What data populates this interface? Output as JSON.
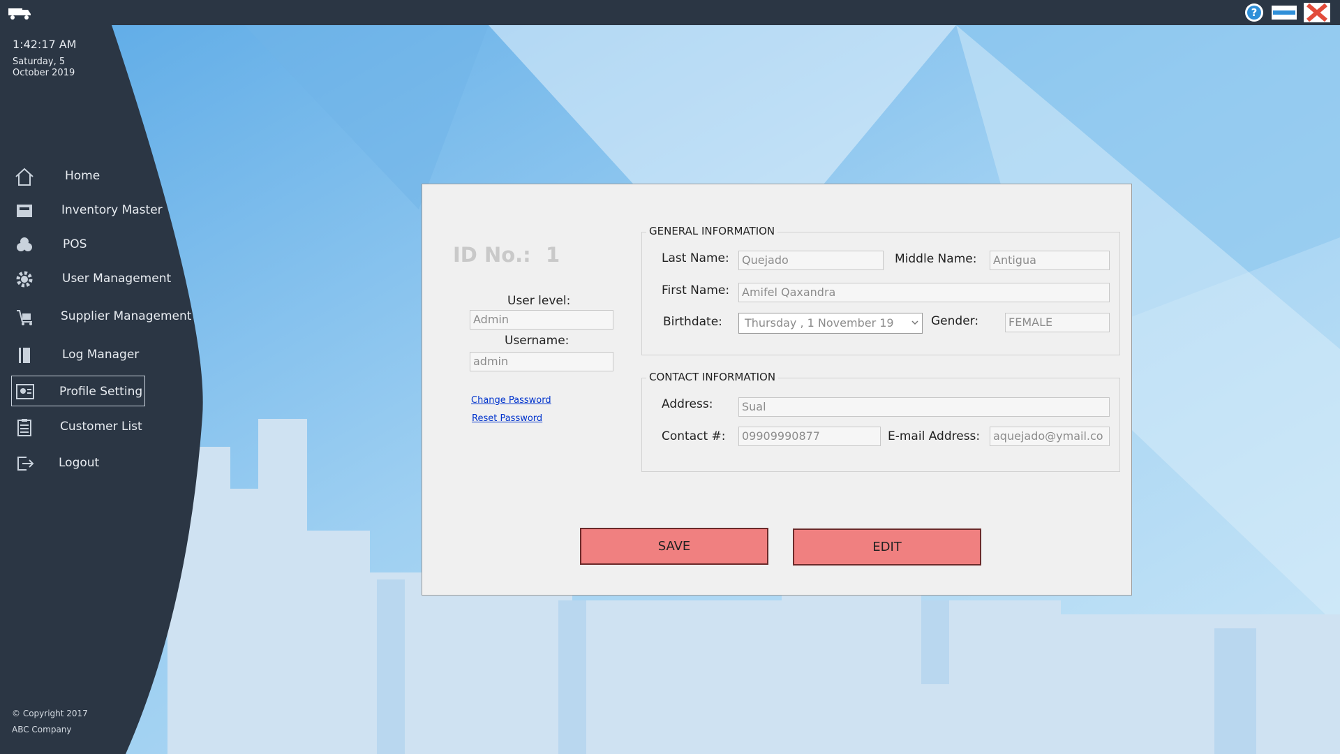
{
  "window": {
    "help_icon": "question-circle-icon",
    "minimize_icon": "minimize-bar-icon",
    "close_icon": "close-x-icon"
  },
  "sidebar": {
    "time": "1:42:17 AM",
    "date": "Saturday, 5 October 2019",
    "items": [
      {
        "label": "Home",
        "icon": "home-icon"
      },
      {
        "label": "Inventory Master",
        "icon": "inventory-icon"
      },
      {
        "label": "POS",
        "icon": "pos-icon"
      },
      {
        "label": "User Management",
        "icon": "gear-icon"
      },
      {
        "label": "Supplier Management",
        "icon": "supplier-icon"
      },
      {
        "label": "Log Manager",
        "icon": "log-icon"
      },
      {
        "label": "Profile Setting",
        "icon": "profile-icon",
        "active": true
      },
      {
        "label": "Customer List",
        "icon": "clipboard-icon"
      },
      {
        "label": "Logout",
        "icon": "logout-icon"
      }
    ],
    "copyright_line1": "© Copyright 2017",
    "copyright_line2": "ABC Company"
  },
  "profile": {
    "id_label": "ID No.:",
    "id_value": "1",
    "user_level_label": "User level:",
    "user_level_value": "Admin",
    "username_label": "Username:",
    "username_value": "admin",
    "change_password": "Change Password",
    "reset_password": "Reset Password"
  },
  "general": {
    "title": "GENERAL INFORMATION",
    "last_name_label": "Last Name:",
    "last_name_value": "Quejado",
    "middle_name_label": "Middle Name:",
    "middle_name_value": "Antigua",
    "first_name_label": "First Name:",
    "first_name_value": "Amifel Qaxandra",
    "birthdate_label": "Birthdate:",
    "birthdate_value": "Thursday   ,   1 November 19",
    "gender_label": "Gender:",
    "gender_value": "FEMALE"
  },
  "contact": {
    "title": "CONTACT INFORMATION",
    "address_label": "Address:",
    "address_value": "Sual",
    "contact_label": "Contact #:",
    "contact_value": "09909990877",
    "email_label": "E-mail Address:",
    "email_value": "aquejado@ymail.co"
  },
  "actions": {
    "save_label": "SAVE",
    "edit_label": "EDIT",
    "accent_color": "#f08080"
  }
}
